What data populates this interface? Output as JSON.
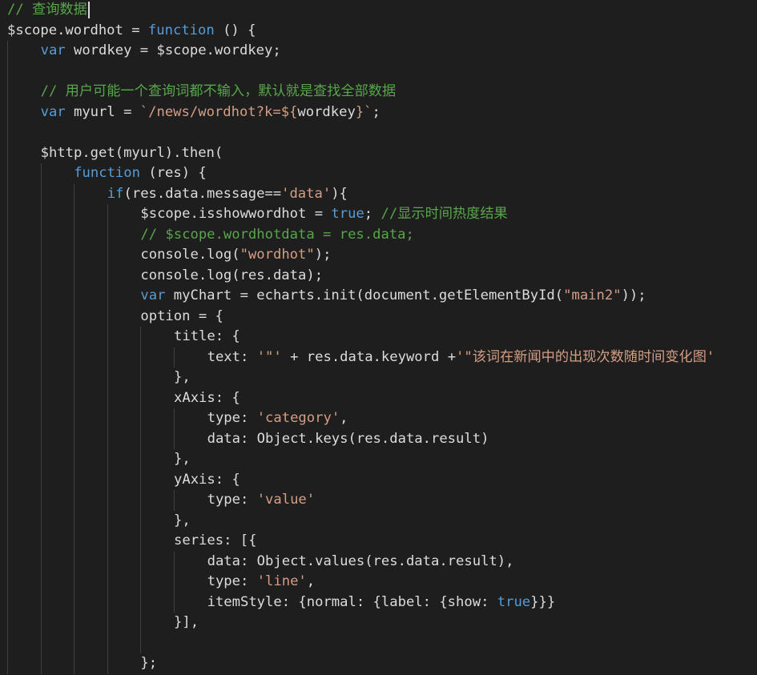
{
  "editor": {
    "theme_colors": {
      "background": "#1e1e1e",
      "plain": "#dcdcdc",
      "keyword": "#569cd6",
      "string": "#d69d85",
      "comment": "#57a64a",
      "indent_guide": "#404040"
    },
    "lines": [
      {
        "indent": 0,
        "tokens": [
          {
            "t": "c",
            "v": "// 查询数据"
          }
        ],
        "cursor": true
      },
      {
        "indent": 0,
        "tokens": [
          {
            "t": "p",
            "v": "$scope.wordhot = "
          },
          {
            "t": "k",
            "v": "function"
          },
          {
            "t": "p",
            "v": " () {"
          }
        ]
      },
      {
        "indent": 1,
        "tokens": [
          {
            "t": "k",
            "v": "var"
          },
          {
            "t": "p",
            "v": " wordkey = $scope.wordkey;"
          }
        ]
      },
      {
        "indent": 1,
        "tokens": []
      },
      {
        "indent": 1,
        "tokens": [
          {
            "t": "c",
            "v": "// 用户可能一个查询词都不输入，默认就是查找全部数据"
          }
        ]
      },
      {
        "indent": 1,
        "tokens": [
          {
            "t": "k",
            "v": "var"
          },
          {
            "t": "p",
            "v": " myurl = "
          },
          {
            "t": "s",
            "v": "`/news/wordhot?k=${"
          },
          {
            "t": "p",
            "v": "wordkey"
          },
          {
            "t": "s",
            "v": "}`"
          },
          {
            "t": "p",
            "v": ";"
          }
        ]
      },
      {
        "indent": 1,
        "tokens": []
      },
      {
        "indent": 1,
        "tokens": [
          {
            "t": "p",
            "v": "$http.get(myurl).then("
          }
        ]
      },
      {
        "indent": 2,
        "tokens": [
          {
            "t": "k",
            "v": "function"
          },
          {
            "t": "p",
            "v": " (res) {"
          }
        ]
      },
      {
        "indent": 3,
        "tokens": [
          {
            "t": "k",
            "v": "if"
          },
          {
            "t": "p",
            "v": "(res.data.message=="
          },
          {
            "t": "s",
            "v": "'data'"
          },
          {
            "t": "p",
            "v": "){"
          }
        ]
      },
      {
        "indent": 4,
        "tokens": [
          {
            "t": "p",
            "v": "$scope.isshowwordhot = "
          },
          {
            "t": "k",
            "v": "true"
          },
          {
            "t": "p",
            "v": "; "
          },
          {
            "t": "c",
            "v": "//显示时间热度结果"
          }
        ]
      },
      {
        "indent": 4,
        "tokens": [
          {
            "t": "c",
            "v": "// $scope.wordhotdata = res.data;"
          }
        ]
      },
      {
        "indent": 4,
        "tokens": [
          {
            "t": "p",
            "v": "console.log("
          },
          {
            "t": "s",
            "v": "\"wordhot\""
          },
          {
            "t": "p",
            "v": ");"
          }
        ]
      },
      {
        "indent": 4,
        "tokens": [
          {
            "t": "p",
            "v": "console.log(res.data);"
          }
        ]
      },
      {
        "indent": 4,
        "tokens": [
          {
            "t": "k",
            "v": "var"
          },
          {
            "t": "p",
            "v": " myChart = echarts.init(document.getElementById("
          },
          {
            "t": "s",
            "v": "\"main2\""
          },
          {
            "t": "p",
            "v": "));"
          }
        ]
      },
      {
        "indent": 4,
        "tokens": [
          {
            "t": "p",
            "v": "option = {"
          }
        ]
      },
      {
        "indent": 5,
        "tokens": [
          {
            "t": "p",
            "v": "title: {"
          }
        ]
      },
      {
        "indent": 6,
        "tokens": [
          {
            "t": "p",
            "v": "text: "
          },
          {
            "t": "s",
            "v": "'\"'"
          },
          {
            "t": "p",
            "v": " + res.data.keyword +"
          },
          {
            "t": "s",
            "v": "'\"该词在新闻中的出现次数随时间变化图'"
          }
        ]
      },
      {
        "indent": 5,
        "tokens": [
          {
            "t": "p",
            "v": "},"
          }
        ]
      },
      {
        "indent": 5,
        "tokens": [
          {
            "t": "p",
            "v": "xAxis: {"
          }
        ]
      },
      {
        "indent": 6,
        "tokens": [
          {
            "t": "p",
            "v": "type: "
          },
          {
            "t": "s",
            "v": "'category'"
          },
          {
            "t": "p",
            "v": ","
          }
        ]
      },
      {
        "indent": 6,
        "tokens": [
          {
            "t": "p",
            "v": "data: Object.keys(res.data.result)"
          }
        ]
      },
      {
        "indent": 5,
        "tokens": [
          {
            "t": "p",
            "v": "},"
          }
        ]
      },
      {
        "indent": 5,
        "tokens": [
          {
            "t": "p",
            "v": "yAxis: {"
          }
        ]
      },
      {
        "indent": 6,
        "tokens": [
          {
            "t": "p",
            "v": "type: "
          },
          {
            "t": "s",
            "v": "'value'"
          }
        ]
      },
      {
        "indent": 5,
        "tokens": [
          {
            "t": "p",
            "v": "},"
          }
        ]
      },
      {
        "indent": 5,
        "tokens": [
          {
            "t": "p",
            "v": "series: [{"
          }
        ]
      },
      {
        "indent": 6,
        "tokens": [
          {
            "t": "p",
            "v": "data: Object.values(res.data.result),"
          }
        ]
      },
      {
        "indent": 6,
        "tokens": [
          {
            "t": "p",
            "v": "type: "
          },
          {
            "t": "s",
            "v": "'line'"
          },
          {
            "t": "p",
            "v": ","
          }
        ]
      },
      {
        "indent": 6,
        "tokens": [
          {
            "t": "p",
            "v": "itemStyle: {normal: {label: {show: "
          },
          {
            "t": "k",
            "v": "true"
          },
          {
            "t": "p",
            "v": "}}}"
          }
        ]
      },
      {
        "indent": 5,
        "tokens": [
          {
            "t": "p",
            "v": "}],"
          }
        ]
      },
      {
        "indent": 5,
        "tokens": []
      },
      {
        "indent": 4,
        "tokens": [
          {
            "t": "p",
            "v": "};"
          }
        ]
      }
    ]
  }
}
